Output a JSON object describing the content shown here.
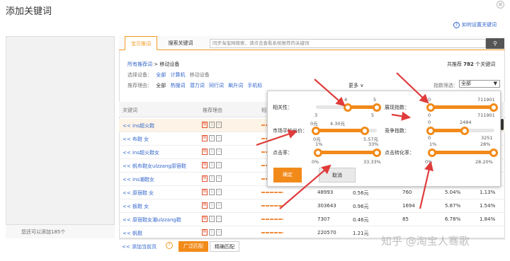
{
  "dialog": {
    "title": "添加关键词",
    "close_icon": "close-icon"
  },
  "help_link": "如何设置关键词",
  "left_panel": {
    "footer": "您还可以添加185个"
  },
  "tabs": [
    {
      "label": "宝贝推词",
      "active": true
    },
    {
      "label": "搜索关键词",
      "active": false
    }
  ],
  "search": {
    "placeholder": "同步淘宝网搜索，请点击查看系统推荐的关键词"
  },
  "total": {
    "prefix": "共推荐",
    "count": "782",
    "suffix": "个关键词"
  },
  "breadcrumb": {
    "root": "所有推荐词",
    "sep": ">",
    "current": "移动设备"
  },
  "device_filter": {
    "label": "选择设备：",
    "options": [
      "全部",
      "计算机",
      "移动设备"
    ]
  },
  "reason_filter": {
    "label": "推荐理由：",
    "options": [
      "全部",
      "热搜词",
      "潜力词",
      "同行词",
      "飙升词",
      "手机标"
    ],
    "more": "更多"
  },
  "index_filter": {
    "label": "指数筛选：",
    "value": "全部"
  },
  "table": {
    "headers": [
      "关键词",
      "推荐理由",
      "相"
    ],
    "rows": [
      {
        "keyword": "<< ins超火鞋",
        "highlight": true,
        "c1": "",
        "c2": "",
        "c3": "",
        "c4": "",
        "c5": ""
      },
      {
        "keyword": "<< 布鞋 女",
        "highlight": false,
        "c1": "",
        "c2": "",
        "c3": "",
        "c4": "",
        "c5": ""
      },
      {
        "keyword": "<< ins超火鞋女",
        "highlight": false,
        "c1": "",
        "c2": "",
        "c3": "",
        "c4": "",
        "c5": ""
      },
      {
        "keyword": "<< 帆布鞋女ulzzang原宿鞋",
        "highlight": false,
        "c1": "",
        "c2": "",
        "c3": "",
        "c4": "",
        "c5": ""
      },
      {
        "keyword": "<< ins潮鞋女",
        "highlight": false,
        "c1": "",
        "c2": "",
        "c3": "",
        "c4": "",
        "c5": ""
      },
      {
        "keyword": "<< 原宿鞋 女",
        "highlight": false,
        "c1": "48993",
        "c2": "0.56元",
        "c3": "760",
        "c4": "5.04%",
        "c5": "1.13%"
      },
      {
        "keyword": "<< 板鞋 女",
        "highlight": false,
        "c1": "303643",
        "c2": "0.96元",
        "c3": "1694",
        "c4": "5.87%",
        "c5": "1.54%"
      },
      {
        "keyword": "<< 原宿鞋女潮ulzzang鞋",
        "highlight": false,
        "c1": "7307",
        "c2": "0.46元",
        "c3": "85",
        "c4": "6.78%",
        "c5": "1.84%"
      },
      {
        "keyword": "<< 帆鞋",
        "highlight": false,
        "c1": "220570",
        "c2": "1.21元",
        "c3": "",
        "c4": "",
        "c5": ""
      }
    ]
  },
  "bottom": {
    "add_page": "<< 添加当前页",
    "broad": "广泛匹配",
    "exact": "精确匹配"
  },
  "popup": {
    "relevance": {
      "label": "相关性：",
      "min": "3",
      "max": "5",
      "sel_min": "4",
      "sel_max": "5"
    },
    "impressions": {
      "label": "展现指数：",
      "min": "0",
      "max": "711901",
      "sel_min": "0",
      "sel_max": "711901"
    },
    "avg_price": {
      "label": "市场平均出价：",
      "min": "0元",
      "max": "5.57元",
      "sel_min": "0元",
      "sel_max": "4.30元"
    },
    "competition": {
      "label": "竞争指数：",
      "min": "0",
      "max": "3251",
      "sel_min": "0",
      "sel_max": "2484"
    },
    "ctr": {
      "label": "点击率：",
      "min": "0%",
      "max": "33.33%",
      "sel_min": "1%",
      "sel_max": "33%"
    },
    "cvr": {
      "label": "点击转化率：",
      "min": "0%",
      "max": "28.20%",
      "sel_min": "1%",
      "sel_max": "28%"
    },
    "ok": "确定",
    "cancel": "取消"
  },
  "watermark": "知乎 @淘宝人骞歌",
  "colors": {
    "accent": "#f28a1a",
    "link": "#3366cc",
    "annotation_arrow": "#e03c3c"
  }
}
